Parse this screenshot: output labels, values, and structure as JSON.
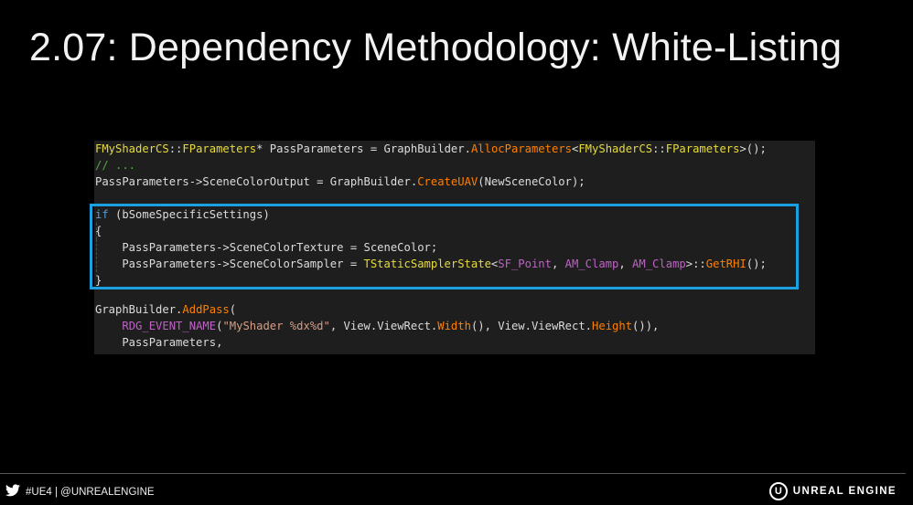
{
  "slide": {
    "title": "2.07: Dependency Methodology: White-Listing"
  },
  "code": {
    "lines": [
      [
        {
          "t": "FMyShaderCS",
          "c": "y"
        },
        {
          "t": "::",
          "c": "t"
        },
        {
          "t": "FParameters",
          "c": "y"
        },
        {
          "t": "* PassParameters = GraphBuilder.",
          "c": "t"
        },
        {
          "t": "AllocParameters",
          "c": "f"
        },
        {
          "t": "<",
          "c": "t"
        },
        {
          "t": "FMyShaderCS",
          "c": "y"
        },
        {
          "t": "::",
          "c": "t"
        },
        {
          "t": "FParameters",
          "c": "y"
        },
        {
          "t": ">();",
          "c": "t"
        }
      ],
      [
        {
          "t": "// ...",
          "c": "c"
        }
      ],
      [
        {
          "t": "PassParameters->SceneColorOutput = GraphBuilder.",
          "c": "t"
        },
        {
          "t": "CreateUAV",
          "c": "f"
        },
        {
          "t": "(NewSceneColor);",
          "c": "t"
        }
      ],
      [],
      [
        {
          "t": "if",
          "c": "k"
        },
        {
          "t": " (bSomeSpecificSettings)",
          "c": "t"
        }
      ],
      [
        {
          "t": "{",
          "c": "t"
        }
      ],
      [
        {
          "t": "    PassParameters->SceneColorTexture = SceneColor;",
          "c": "t"
        }
      ],
      [
        {
          "t": "    PassParameters->SceneColorSampler = ",
          "c": "t"
        },
        {
          "t": "TStaticSamplerState",
          "c": "y"
        },
        {
          "t": "<",
          "c": "t"
        },
        {
          "t": "SF_Point",
          "c": "m"
        },
        {
          "t": ", ",
          "c": "t"
        },
        {
          "t": "AM_Clamp",
          "c": "m"
        },
        {
          "t": ", ",
          "c": "t"
        },
        {
          "t": "AM_Clamp",
          "c": "m"
        },
        {
          "t": ">::",
          "c": "t"
        },
        {
          "t": "GetRHI",
          "c": "f"
        },
        {
          "t": "();",
          "c": "t"
        }
      ],
      [
        {
          "t": "}",
          "c": "t"
        }
      ],
      [],
      [
        {
          "t": "GraphBuilder.",
          "c": "t"
        },
        {
          "t": "AddPass",
          "c": "f"
        },
        {
          "t": "(",
          "c": "t"
        }
      ],
      [
        {
          "t": "    ",
          "c": "t"
        },
        {
          "t": "RDG_EVENT_NAME",
          "c": "m"
        },
        {
          "t": "(",
          "c": "t"
        },
        {
          "t": "\"MyShader %dx%d\"",
          "c": "s"
        },
        {
          "t": ", View.ViewRect.",
          "c": "t"
        },
        {
          "t": "Width",
          "c": "f"
        },
        {
          "t": "(), View.ViewRect.",
          "c": "t"
        },
        {
          "t": "Height",
          "c": "f"
        },
        {
          "t": "()),",
          "c": "t"
        }
      ],
      [
        {
          "t": "    PassParameters,",
          "c": "t"
        }
      ]
    ]
  },
  "footer": {
    "social_icon": "twitter-bird-icon",
    "hashtag": "#UE4 | @UNREALENGINE",
    "brand_logo": "unreal-engine-logo",
    "brand_mark": "U",
    "brand": "UNREAL ENGINE"
  },
  "colors": {
    "background": "#000000",
    "code_background": "#1e1e1e",
    "highlight_border": "#1ba1e2"
  }
}
